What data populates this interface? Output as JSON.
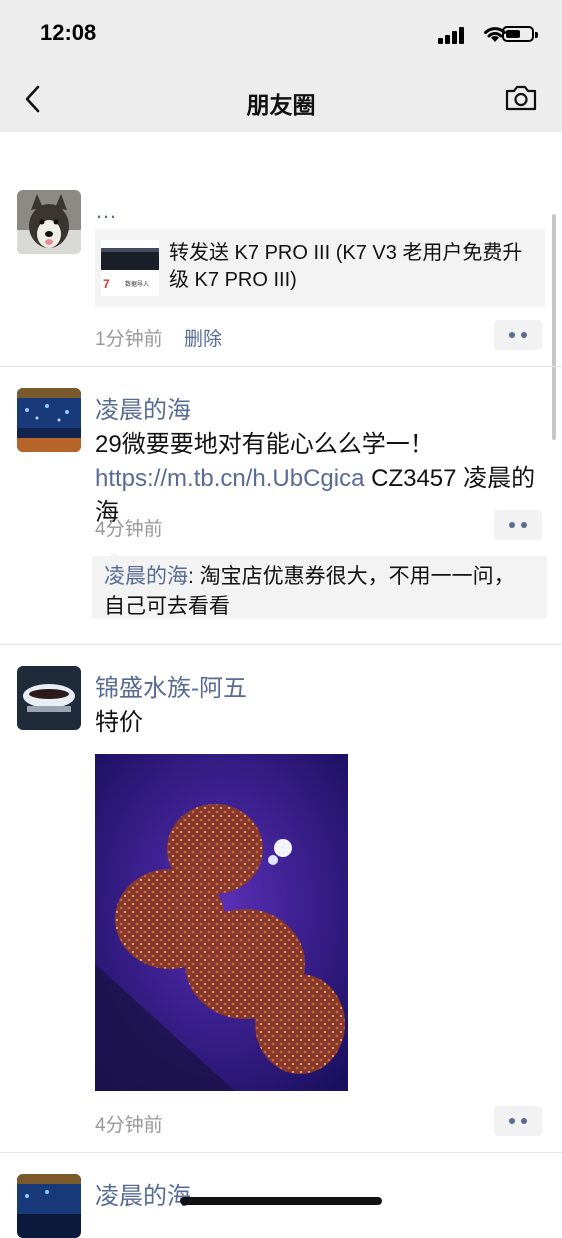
{
  "status": {
    "time": "12:08"
  },
  "nav": {
    "title": "朋友圈"
  },
  "posts": [
    {
      "author": "…",
      "share_title": "转发送 K7 PRO III (K7 V3 老用户免费升级 K7 PRO III)",
      "thumb_caption": "数据导入",
      "time": "1分钟前",
      "delete": "删除"
    },
    {
      "author": "凌晨的海",
      "text_plain": "29微要要地对有能心么么学一！ ",
      "link": "https://m.tb.cn/h.UbCgica",
      "text_tail": " CZ3457 凌晨的海",
      "time": "4分钟前",
      "comment_author": "凌晨的海",
      "comment_text": ": 淘宝店优惠券很大，不用一一问，自己可去看看"
    },
    {
      "author": "锦盛水族-阿五",
      "text": "特价",
      "time": "4分钟前"
    },
    {
      "author": "凌晨的海"
    }
  ],
  "colors": {
    "link": "#576b95",
    "time": "#999999",
    "nav_bg": "#ededed"
  }
}
